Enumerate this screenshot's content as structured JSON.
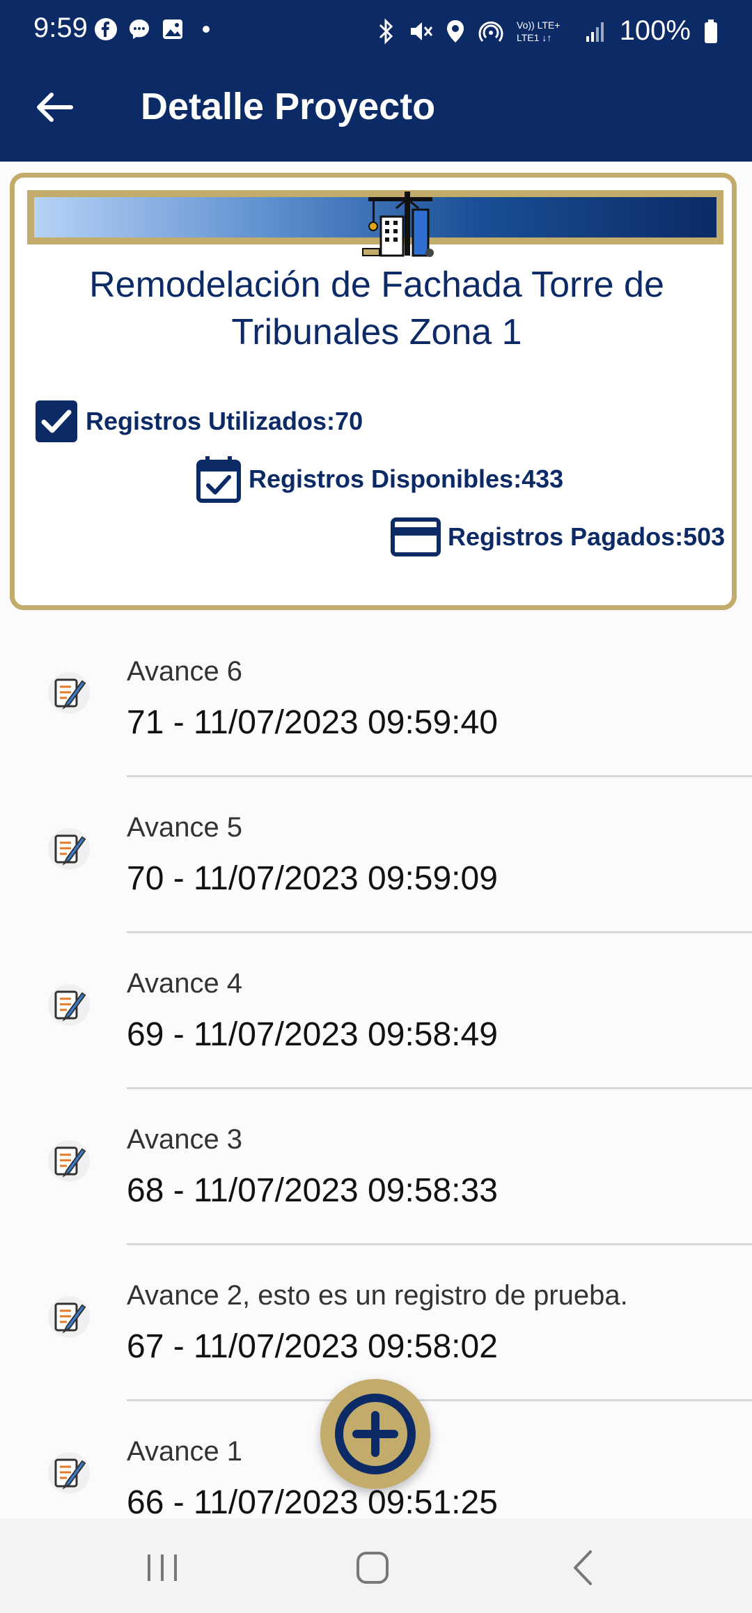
{
  "status_bar": {
    "time": "9:59",
    "battery": "100%",
    "left_icons": [
      "facebook-icon",
      "messenger-icon",
      "gallery-icon",
      "dot-icon"
    ],
    "right_icons": [
      "bluetooth-icon",
      "mute-icon",
      "location-icon",
      "hotspot-icon",
      "volte-icon",
      "signal-icon",
      "battery-icon"
    ]
  },
  "app_bar": {
    "title": "Detalle Proyecto"
  },
  "project": {
    "title": "Remodelación de Fachada Torre de Tribunales Zona 1",
    "stats": {
      "used": "Registros Utilizados:70",
      "available": "Registros Disponibles:433",
      "paid": "Registros Pagados:503"
    }
  },
  "entries": [
    {
      "title": "Avance 6",
      "subtitle": "71 - 11/07/2023 09:59:40"
    },
    {
      "title": "Avance 5",
      "subtitle": "70 - 11/07/2023 09:59:09"
    },
    {
      "title": "Avance 4",
      "subtitle": "69 - 11/07/2023 09:58:49"
    },
    {
      "title": "Avance 3",
      "subtitle": "68 - 11/07/2023 09:58:33"
    },
    {
      "title": "Avance 2, esto es un registro de prueba.",
      "subtitle": "67 - 11/07/2023 09:58:02"
    },
    {
      "title": "Avance 1",
      "subtitle": "66 - 11/07/2023 09:51:25"
    }
  ],
  "colors": {
    "primary": "#0b2a66",
    "accent": "#c3ac6b"
  }
}
